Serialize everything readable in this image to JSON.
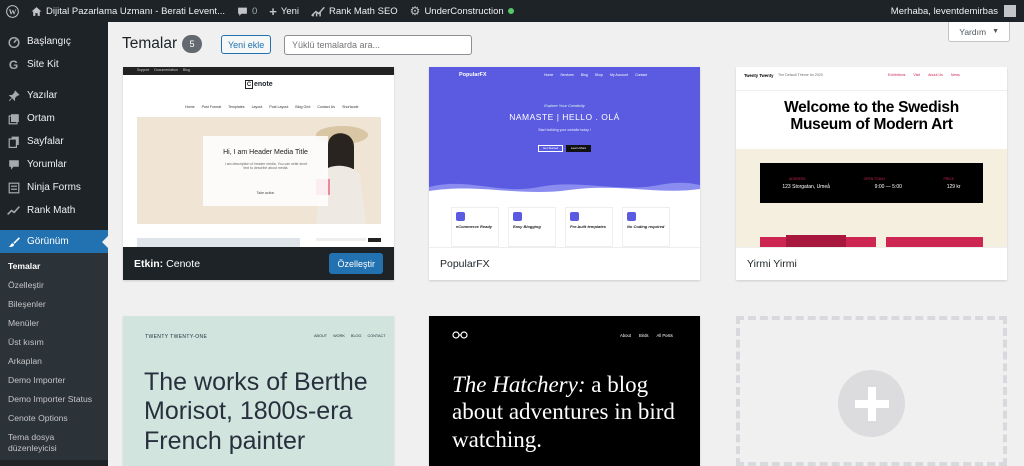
{
  "adminbar": {
    "site_name": "Dijital Pazarlama Uzmanı - Berati Levent...",
    "comments_count": "0",
    "new_label": "Yeni",
    "rankmath_label": "Rank Math SEO",
    "underconstruction_label": "UnderConstruction",
    "greeting": "Merhaba, leventdemirbas"
  },
  "sidebar": {
    "items": [
      {
        "label": "Başlangıç",
        "icon": "dashboard-icon"
      },
      {
        "label": "Site Kit",
        "icon": "google-g-icon"
      },
      {
        "label": "Yazılar",
        "icon": "pin-icon"
      },
      {
        "label": "Ortam",
        "icon": "media-icon"
      },
      {
        "label": "Sayfalar",
        "icon": "pages-icon"
      },
      {
        "label": "Yorumlar",
        "icon": "comment-icon"
      },
      {
        "label": "Ninja Forms",
        "icon": "form-icon"
      },
      {
        "label": "Rank Math",
        "icon": "chart-icon"
      },
      {
        "label": "Görünüm",
        "icon": "brush-icon"
      }
    ],
    "submenu": [
      "Temalar",
      "Özelleştir",
      "Bileşenler",
      "Menüler",
      "Üst kısım",
      "Arkaplan",
      "Demo Importer",
      "Demo Importer Status",
      "Cenote Options",
      "Tema dosya düzenleyicisi"
    ]
  },
  "header": {
    "title": "Temalar",
    "count": "5",
    "add_new": "Yeni ekle",
    "search_placeholder": "Yüklü temalarda ara...",
    "help": "Yardım"
  },
  "themes": [
    {
      "name": "Cenote",
      "active_prefix": "Etkin:",
      "customize": "Özelleştir",
      "preview": {
        "logo": "enote",
        "logo_badge": "C",
        "nav": [
          "Home",
          "Post Format",
          "Templates",
          "Layout",
          "Post Layout",
          "Blog Grid",
          "Contact Us",
          "Shortcode"
        ],
        "topbar": [
          "Support",
          "Documentation",
          "Blog"
        ],
        "hero_title": "Hi, I am Header Media Title",
        "hero_text": "I am description of header media. You can write short text to describe about media.",
        "hero_link": "Take action"
      }
    },
    {
      "name": "PopularFX",
      "preview": {
        "brand": "PopularFX",
        "nav": [
          "Home",
          "Services",
          "Blog",
          "Shop",
          "My Account",
          "Contact"
        ],
        "tagline": "Explore Your Creativity",
        "headline": "NAMASTE | HELLO . OLÁ",
        "sub": "Start building your website today !",
        "btn1": "Get Started",
        "btn2": "Learn More",
        "features": [
          "eCommerce Ready",
          "Easy Blogging",
          "Pre-built templates",
          "No Coding required"
        ]
      }
    },
    {
      "name": "Yirmi Yirmi",
      "preview": {
        "site": "Twenty Twenty",
        "desc": "The Default Theme for 2020",
        "nav": [
          "Exhibitions",
          "Visit",
          "About Us",
          "News"
        ],
        "headline": "Welcome to the Swedish Museum of Modern Art",
        "info_labels": [
          "ADDRESS",
          "OPEN TODAY",
          "PRICE"
        ],
        "info_values": [
          "123 Storgatan, Umeå",
          "9:00 — 5:00",
          "129 kr"
        ]
      }
    },
    {
      "preview": {
        "site": "TWENTY TWENTY-ONE",
        "nav": [
          "ABOUT",
          "WORK",
          "BLOG",
          "CONTACT"
        ],
        "headline": "The works of Berthe Morisot, 1800s-era French painter"
      }
    },
    {
      "preview": {
        "nav": [
          "About",
          "Birds",
          "All Posts"
        ],
        "headline_italic": "The Hatchery:",
        "headline_rest": "a blog about adventures in bird watching."
      }
    }
  ],
  "colors": {
    "accent": "#2271b1",
    "adminbar": "#1d2327",
    "popularfx": "#5a5be0",
    "tt1_bg": "#d1e4dd",
    "museum_maroon": "#cd2653"
  }
}
